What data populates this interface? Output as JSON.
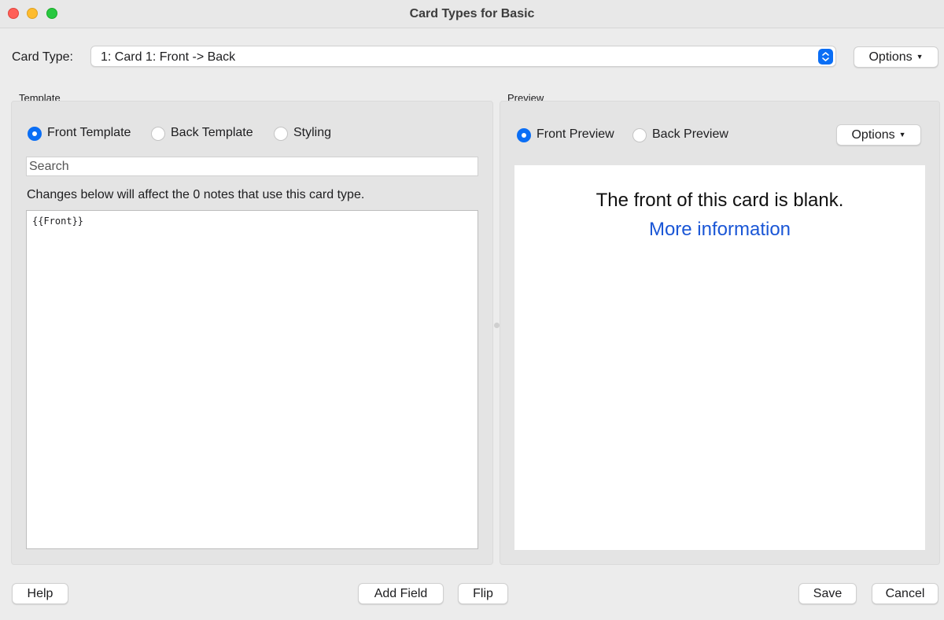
{
  "window": {
    "title": "Card Types for Basic"
  },
  "card_type": {
    "label": "Card Type:",
    "selected": "1: Card 1: Front -> Back",
    "options_button": "Options"
  },
  "template": {
    "group_label": "Template",
    "radios": [
      {
        "label": "Front Template",
        "checked": true
      },
      {
        "label": "Back Template",
        "checked": false
      },
      {
        "label": "Styling",
        "checked": false
      }
    ],
    "search_placeholder": "Search",
    "info_text": "Changes below will affect the 0 notes that use this card type.",
    "editor_content": "{{Front}}"
  },
  "preview": {
    "group_label": "Preview",
    "radios": [
      {
        "label": "Front Preview",
        "checked": true
      },
      {
        "label": "Back Preview",
        "checked": false
      }
    ],
    "options_button": "Options",
    "blank_message": "The front of this card is blank.",
    "more_info_link": "More information"
  },
  "footer": {
    "help": "Help",
    "add_field": "Add Field",
    "flip": "Flip",
    "save": "Save",
    "cancel": "Cancel"
  },
  "colors": {
    "accent": "#0a6ef5",
    "link": "#1a56d6",
    "close": "#ff5f57",
    "minimize": "#febc2e",
    "maximize": "#28c840"
  }
}
